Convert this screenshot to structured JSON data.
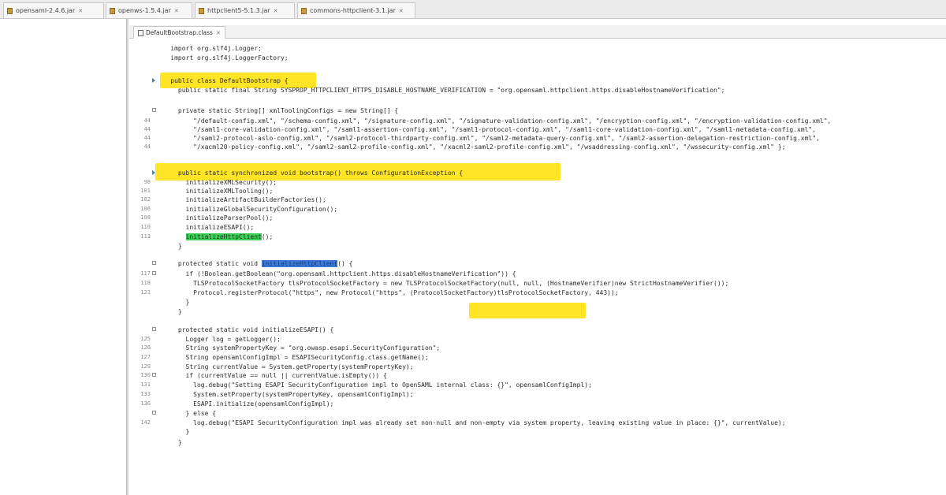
{
  "top_tabs": [
    {
      "label": "opensaml-2.4.6.jar"
    },
    {
      "label": "openws-1.5.4.jar"
    },
    {
      "label": "httpclient5-5.1.3.jar"
    },
    {
      "label": "commons-httpclient-3.1.jar"
    }
  ],
  "editor": {
    "tab_label": "DefaultBootstrap.class"
  },
  "code": {
    "lines": [
      {
        "num": "",
        "text": "    import org.slf4j.Logger;"
      },
      {
        "num": "",
        "text": "    import org.slf4j.LoggerFactory;"
      },
      {
        "num": "",
        "text": ""
      },
      {
        "num": "",
        "text": "    public class DefaultBootstrap {"
      },
      {
        "num": "",
        "text": "      public static final String SYSPROP_HTTPCLIENT_HTTPS_DISABLE_HOSTNAME_VERIFICATION = \"org.opensaml.httpclient.https.disableHostnameVerification\";"
      },
      {
        "num": "",
        "text": ""
      },
      {
        "num": "",
        "text": "      private static String[] xmlToolingConfigs = new String[] {"
      },
      {
        "num": "44",
        "text": "          \"/default-config.xml\", \"/schema-config.xml\", \"/signature-config.xml\", \"/signature-validation-config.xml\", \"/encryption-config.xml\", \"/encryption-validation-config.xml\","
      },
      {
        "num": "44",
        "text": "          \"/saml1-core-validation-config.xml\", \"/saml1-assertion-config.xml\", \"/saml1-protocol-config.xml\", \"/saml1-core-validation-config.xml\", \"/saml1-metadata-config.xml\","
      },
      {
        "num": "44",
        "text": "          \"/saml2-protocol-aslo-config.xml\", \"/saml2-protocol-thirdparty-config.xml\", \"/saml2-metadata-query-config.xml\", \"/saml2-assertion-delegation-restriction-config.xml\","
      },
      {
        "num": "44",
        "text": "          \"/xacml20-policy-config.xml\", \"/saml2-saml2-profile-config.xml\", \"/xacml2-saml2-profile-config.xml\", \"/wsaddressing-config.xml\", \"/wssecurity-config.xml\" };"
      },
      {
        "num": "",
        "text": ""
      },
      {
        "num": "",
        "text": "      public static synchronized void bootstrap() throws ConfigurationException {"
      },
      {
        "num": "98",
        "text": "        initializeXMLSecurity();"
      },
      {
        "num": "101",
        "text": "        initializeXMLTooling();"
      },
      {
        "num": "102",
        "text": "        initializeArtifactBuilderFactories();"
      },
      {
        "num": "106",
        "text": "        initializeGlobalSecurityConfiguration();"
      },
      {
        "num": "108",
        "text": "        initializeParserPool();"
      },
      {
        "num": "110",
        "text": "        initializeESAPI();"
      },
      {
        "num": "113",
        "text": "        initializeHttpClient();"
      },
      {
        "num": "",
        "text": "      }"
      },
      {
        "num": "",
        "text": ""
      },
      {
        "num": "",
        "text": "      protected static void initializeHttpClient() {"
      },
      {
        "num": "117",
        "text": "        if (!Boolean.getBoolean(\"org.opensaml.httpclient.https.disableHostnameVerification\")) {"
      },
      {
        "num": "118",
        "text": "          TLSProtocolSocketFactory tlsProtocolSocketFactory = new TLSProtocolSocketFactory(null, null, (HostnameVerifier)new StrictHostnameVerifier());"
      },
      {
        "num": "121",
        "text": "          Protocol.registerProtocol(\"https\", new Protocol(\"https\", (ProtocolSocketFactory)tlsProtocolSocketFactory, 443));"
      },
      {
        "num": "",
        "text": "        }"
      },
      {
        "num": "",
        "text": "      }"
      },
      {
        "num": "",
        "text": ""
      },
      {
        "num": "",
        "text": "      protected static void initializeESAPI() {"
      },
      {
        "num": "125",
        "text": "        Logger log = getLogger();"
      },
      {
        "num": "126",
        "text": "        String systemPropertyKey = \"org.owasp.esapi.SecurityConfiguration\";"
      },
      {
        "num": "127",
        "text": "        String opensamlConfigImpl = ESAPISecurityConfig.class.getName();"
      },
      {
        "num": "129",
        "text": "        String currentValue = System.getProperty(systemPropertyKey);"
      },
      {
        "num": "130",
        "text": "        if (currentValue == null || currentValue.isEmpty()) {"
      },
      {
        "num": "131",
        "text": "          log.debug(\"Setting ESAPI SecurityConfiguration impl to OpenSAML internal class: {}\", opensamlConfigImpl);"
      },
      {
        "num": "133",
        "text": "          System.setProperty(systemPropertyKey, opensamlConfigImpl);"
      },
      {
        "num": "136",
        "text": "          ESAPI.initialize(opensamlConfigImpl);"
      },
      {
        "num": "",
        "text": "        } else {"
      },
      {
        "num": "142",
        "text": "          log.debug(\"ESAPI SecurityConfiguration impl was already set non-null and non-empty via system property, leaving existing value in place: {}\", currentValue);"
      },
      {
        "num": "",
        "text": "        }"
      },
      {
        "num": "",
        "text": "      }"
      }
    ]
  }
}
